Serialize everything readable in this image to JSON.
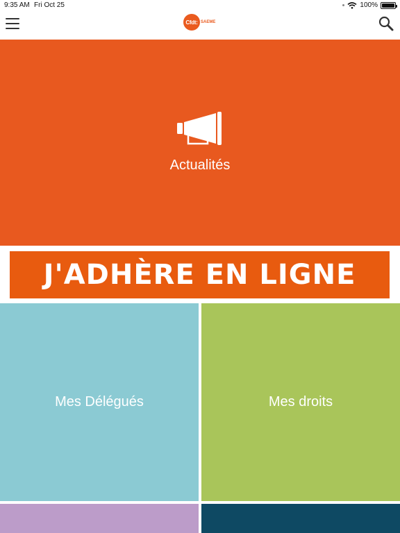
{
  "status_bar": {
    "time": "9:35 AM",
    "date": "Fri Oct 25",
    "battery": "100%"
  },
  "header": {
    "logo_text": "Cfdt:",
    "logo_sub": "SAEME",
    "menu_icon": "hamburger-icon",
    "search_icon": "search-icon"
  },
  "tiles": {
    "news": {
      "label": "Actualités",
      "icon": "megaphone-icon",
      "color": "#e8591f"
    },
    "banner": {
      "label": "J'ADHÈRE EN LIGNE",
      "color": "#e85b0f"
    },
    "delegates": {
      "label": "Mes Délégués",
      "color": "#8bcad3"
    },
    "rights": {
      "label": "Mes droits",
      "color": "#a9c55a"
    },
    "bottom_left": {
      "label": "",
      "color": "#bc9cc9"
    },
    "bottom_right": {
      "label": "",
      "color": "#0e4963"
    }
  }
}
